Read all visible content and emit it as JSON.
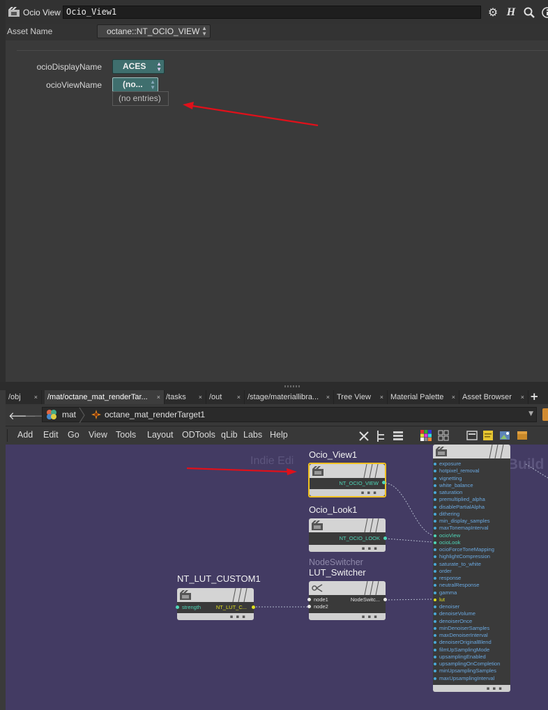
{
  "param_pane": {
    "node_type_label": "Ocio View",
    "node_name": "Ocio_View1",
    "header_icons": [
      "gear-icon",
      "houdini-help-icon",
      "search-icon",
      "info-icon"
    ],
    "asset_name_label": "Asset Name",
    "asset_name_value": "octane::NT_OCIO_VIEW",
    "params": [
      {
        "label": "ocioDisplayName",
        "value": "ACES"
      },
      {
        "label": "ocioViewName",
        "value": "(no..."
      }
    ],
    "popup_text": "(no entries)"
  },
  "tabs": [
    {
      "label": "/obj"
    },
    {
      "label": "/mat/octane_mat_renderTar..."
    },
    {
      "label": "/tasks"
    },
    {
      "label": "/out"
    },
    {
      "label": "/stage/materiallibra..."
    },
    {
      "label": "Tree View"
    },
    {
      "label": "Material Palette"
    },
    {
      "label": "Asset Browser"
    }
  ],
  "tab_add": "+",
  "tab_close": "×",
  "path": {
    "segments": [
      "mat",
      "octane_mat_renderTarget1"
    ]
  },
  "menu": [
    "Add",
    "Edit",
    "Go",
    "View",
    "Tools",
    "Layout",
    "ODTools",
    "qLib",
    "Labs",
    "Help"
  ],
  "network": {
    "watermark_left": "Indie Edi",
    "watermark_right": "VEX Build",
    "nodes": {
      "ocio_view": {
        "title": "Ocio_View1",
        "out_label": "NT_OCIO_VIEW"
      },
      "ocio_look": {
        "title": "Ocio_Look1",
        "out_label": "NT_OCIO_LOOK"
      },
      "lut_switcher": {
        "subtitle": "NodeSwitcher",
        "title": "LUT_Switcher",
        "in1": "node1",
        "in2": "node2",
        "out_label": "NodeSwitc..."
      },
      "lut_custom": {
        "title": "NT_LUT_CUSTOM1",
        "in_label": "strength",
        "out_label": "NT_LUT_C..."
      }
    },
    "render_target_params": [
      "exposure",
      "hotpixel_removal",
      "vignetting",
      "white_balance",
      "saturation",
      "premultiplied_alpha",
      "disablePartialAlpha",
      "dithering",
      "min_display_samples",
      "maxTonemapInterval",
      "ocioView",
      "ocioLook",
      "ocioForceToneMapping",
      "highlightCompression",
      "saturate_to_white",
      "order",
      "response",
      "neutralResponse",
      "gamma",
      "lut",
      "denoiser",
      "denoiseVolume",
      "denoiserOnce",
      "minDenoiserSamples",
      "maxDenoiserInterval",
      "denoiserOriginalBlend",
      "filmUpSamplingMode",
      "upsamplingEnabled",
      "upsamplingOnCompletion",
      "minUpsamplingSamples",
      "maxUpsamplingInterval"
    ]
  },
  "colors": {
    "network_bg": "#433b63",
    "teal_button": "#3f6f6e",
    "selected_node": "#f0c020",
    "annotation_arrow": "#e0101a",
    "param_label_blue": "#6aa8e0",
    "lut_label_yellow": "#e0e020"
  }
}
